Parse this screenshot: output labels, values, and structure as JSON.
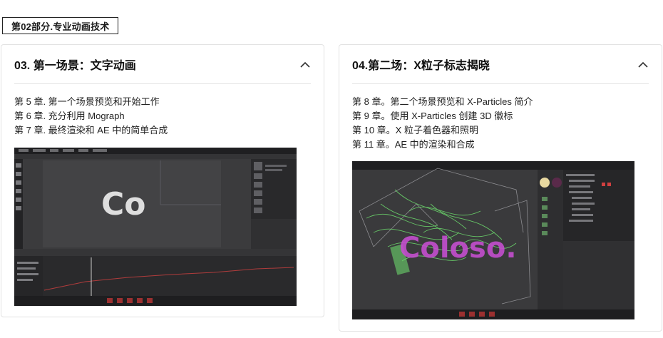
{
  "section": {
    "label": "第02部分.专业动画技术"
  },
  "cards": [
    {
      "title": "03. 第一场景：文字动画",
      "chapters": [
        "第 5 章. 第一个场景预览和开始工作",
        "第 6 章. 充分利用 Mograph",
        "第 7 章. 最终渲染和 AE 中的简单合成"
      ],
      "preview_text": "Co"
    },
    {
      "title": "04.第二场：X粒子标志揭晓",
      "chapters": [
        "第 8 章。第二个场景预览和 X-Particles 简介",
        "第 9 章。使用 X-Particles 创建 3D 徽标",
        "第 10 章。X 粒子着色器和照明",
        "第 11 章。AE 中的渲染和合成"
      ],
      "preview_text": "Coloso."
    }
  ],
  "colors": {
    "accent_green": "#6bd56b",
    "accent_magenta": "#c44fcf",
    "viewport_bg": "#3a3a3c"
  },
  "icons": {
    "collapse": "chevron-up-icon"
  }
}
